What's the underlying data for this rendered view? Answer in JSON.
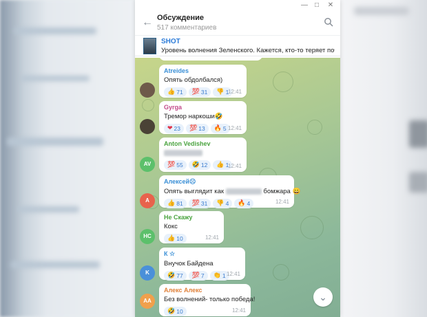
{
  "header": {
    "title": "Обсуждение",
    "subtitle": "517 комментариев",
    "back_icon": "arrow-left-icon",
    "search_icon": "search-icon"
  },
  "window_controls": [
    "minimize-icon",
    "maximize-icon",
    "close-icon"
  ],
  "pinned": {
    "name": "SHOT",
    "text": "Уровень волнения Зеленского. Кажется, кто-то теряет почву ..."
  },
  "messages": [
    {
      "author": "Atreides",
      "author_color": "#3a8fd6",
      "avatar": {
        "initials": "",
        "color": "#6e5a4a",
        "type": "photo"
      },
      "text": "Опять обдолбался)",
      "reactions": [
        {
          "emoji": "👍",
          "count": "71"
        },
        {
          "emoji": "💯",
          "count": "31"
        },
        {
          "emoji": "👎",
          "count": "1"
        }
      ],
      "time": "12:41"
    },
    {
      "author": "Gyrga",
      "author_color": "#c24a8a",
      "avatar": {
        "initials": "",
        "color": "#4a4236",
        "type": "photo"
      },
      "text": "Тремор наркоши🤣",
      "reactions": [
        {
          "emoji": "❤",
          "count": "23"
        },
        {
          "emoji": "💯",
          "count": "13"
        },
        {
          "emoji": "🔥",
          "count": "5"
        }
      ],
      "time": "12:41"
    },
    {
      "author": "Anton Vedishev",
      "author_color": "#4aa33f",
      "avatar": {
        "initials": "AV",
        "color": "#5cc06b",
        "type": "initials"
      },
      "text": "",
      "redacted": true,
      "reactions": [
        {
          "emoji": "💯",
          "count": "55"
        },
        {
          "emoji": "🤣",
          "count": "12"
        },
        {
          "emoji": "👍",
          "count": "1"
        }
      ],
      "time": "12:41"
    },
    {
      "author": "Алексей☹",
      "author_color": "#3a8fd6",
      "avatar": {
        "initials": "А",
        "color": "#e8634c",
        "type": "initials"
      },
      "text_before": "Опять выглядит как",
      "text_after": "бомжара 😄",
      "reactions": [
        {
          "emoji": "👍",
          "count": "81"
        },
        {
          "emoji": "💯",
          "count": "31"
        },
        {
          "emoji": "👎",
          "count": "4"
        },
        {
          "emoji": "🔥",
          "count": "4"
        }
      ],
      "time": "12:41"
    },
    {
      "author": "Не Скажу",
      "author_color": "#4aa33f",
      "avatar": {
        "initials": "НС",
        "color": "#5cc06b",
        "type": "initials"
      },
      "text": "Кокс",
      "reactions": [
        {
          "emoji": "👍",
          "count": "10"
        }
      ],
      "time": "12:41"
    },
    {
      "author": "К ☆",
      "author_color": "#3a8fd6",
      "avatar": {
        "initials": "K",
        "color": "#4a90d9",
        "type": "initials"
      },
      "text": "Внучок Байдена",
      "reactions": [
        {
          "emoji": "🤣",
          "count": "77"
        },
        {
          "emoji": "💯",
          "count": "7"
        },
        {
          "emoji": "👏",
          "count": "1"
        }
      ],
      "time": "12:41"
    },
    {
      "author": "Алекс Алекс",
      "author_color": "#e0813a",
      "avatar": {
        "initials": "АА",
        "color": "#f0a04c",
        "type": "initials"
      },
      "text": "Без волнений- только победа!",
      "reactions": [
        {
          "emoji": "🤣",
          "count": "10"
        }
      ],
      "time": "12:41"
    }
  ],
  "scroll_down_icon": "chevron-down-icon"
}
